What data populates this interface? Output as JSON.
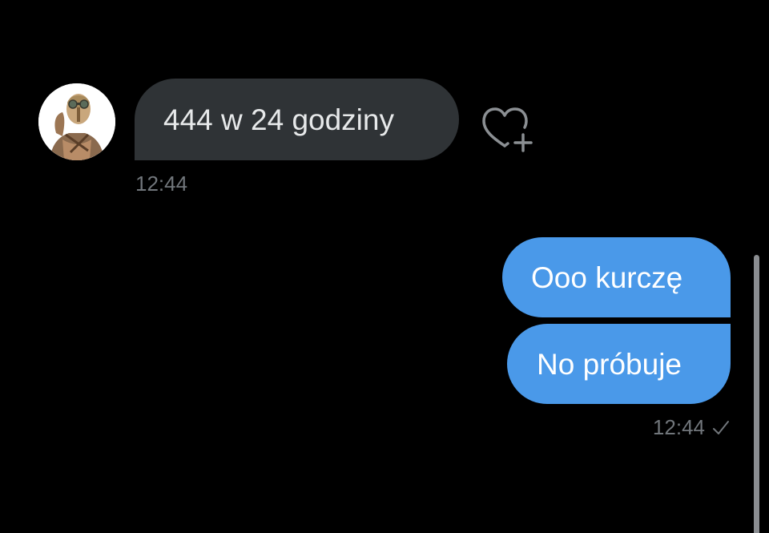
{
  "conversation": {
    "messages": [
      {
        "direction": "incoming",
        "text": "444 w 24 godziny",
        "time": "12:44",
        "reaction_icon": "heart-plus-icon"
      },
      {
        "direction": "outgoing",
        "text": "Ooo kurczę"
      },
      {
        "direction": "outgoing",
        "text": "No próbuje",
        "time": "12:44",
        "status_icon": "checkmark-icon"
      }
    ]
  },
  "colors": {
    "background": "#000000",
    "incoming_bubble": "#2f3336",
    "outgoing_bubble": "#4a99e9",
    "timestamp": "#71767b"
  }
}
